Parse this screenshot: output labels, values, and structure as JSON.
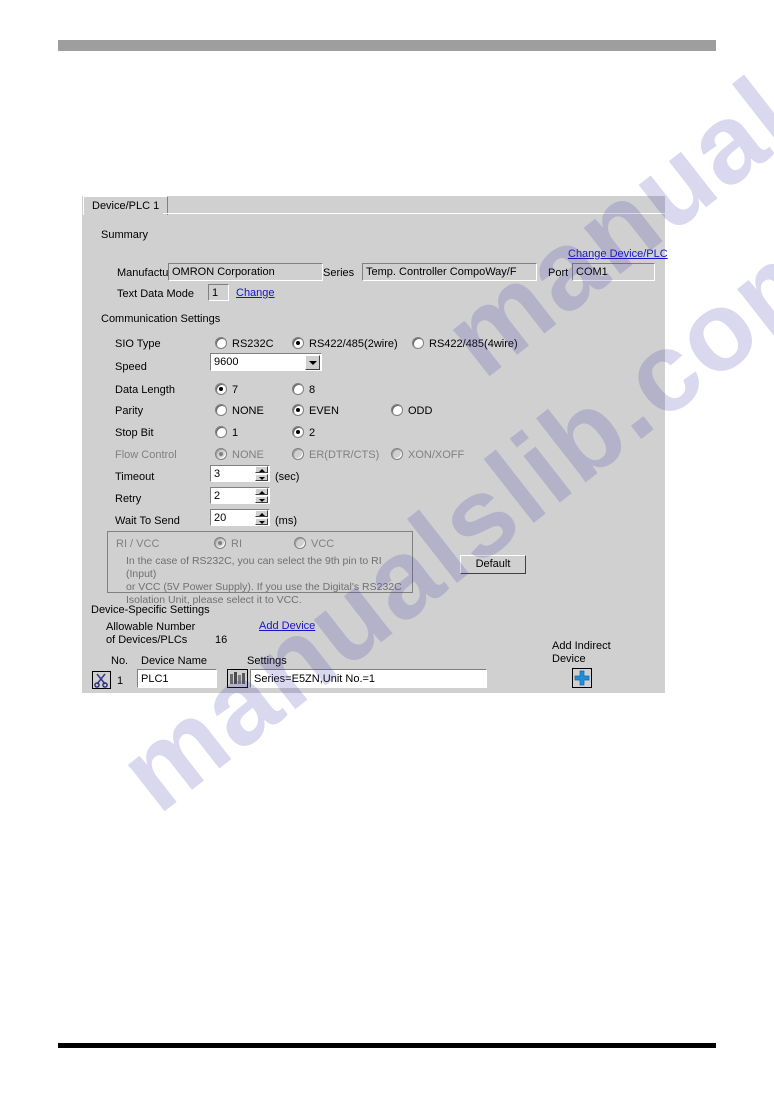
{
  "dialog": {
    "tab_label": "Device/PLC 1",
    "summary": {
      "section_title": "Summary",
      "manufacturer_label": "Manufacturer",
      "manufacturer_value": "OMRON Corporation",
      "series_label": "Series",
      "series_value": "Temp. Controller CompoWay/F",
      "port_label": "Port",
      "port_value": "COM1",
      "text_data_mode_label": "Text Data Mode",
      "text_data_mode_value": "1",
      "change_link": "Change",
      "change_device_link": "Change Device/PLC"
    },
    "communication": {
      "section_title": "Communication Settings",
      "sio_type_label": "SIO Type",
      "sio_options": [
        "RS232C",
        "RS422/485(2wire)",
        "RS422/485(4wire)"
      ],
      "sio_selected": "RS422/485(2wire)",
      "speed_label": "Speed",
      "speed_value": "9600",
      "data_length_label": "Data Length",
      "data_length_options": [
        "7",
        "8"
      ],
      "data_length_selected": "7",
      "parity_label": "Parity",
      "parity_options": [
        "NONE",
        "EVEN",
        "ODD"
      ],
      "parity_selected": "EVEN",
      "stop_bit_label": "Stop Bit",
      "stop_bit_options": [
        "1",
        "2"
      ],
      "stop_bit_selected": "2",
      "flow_control_label": "Flow Control",
      "flow_control_options": [
        "NONE",
        "ER(DTR/CTS)",
        "XON/XOFF"
      ],
      "flow_control_selected": "NONE",
      "timeout_label": "Timeout",
      "timeout_value": "3",
      "timeout_unit": "(sec)",
      "retry_label": "Retry",
      "retry_value": "2",
      "wait_to_send_label": "Wait To Send",
      "wait_to_send_value": "20",
      "wait_to_send_unit": "(ms)"
    },
    "rivcc": {
      "title": "RI / VCC",
      "options": [
        "RI",
        "VCC"
      ],
      "selected": "RI",
      "help_text": "In the case of RS232C, you can select the 9th pin to RI (Input)\nor VCC (5V Power Supply). If you use the Digital's RS232C\nIsolation Unit, please select it to VCC."
    },
    "default_button": "Default",
    "device_specific": {
      "section_title": "Device-Specific Settings",
      "allowable_label_line1": "Allowable Number",
      "allowable_label_line2": "of Devices/PLCs",
      "allowable_count": "16",
      "add_device_link": "Add Device",
      "col_no": "No.",
      "col_device_name": "Device Name",
      "col_settings": "Settings",
      "rows": [
        {
          "no": "1",
          "device_name": "PLC1",
          "settings": "Series=E5ZN,Unit No.=1"
        }
      ],
      "add_indirect_line1": "Add Indirect",
      "add_indirect_line2": "Device"
    }
  },
  "watermark": {
    "text_a": "manualslib.com",
    "text_b": "manualslib.com"
  },
  "colors": {
    "dialog_face": "#d0d0d0",
    "link": "#1414c8",
    "accent_plus": "#1e90d8",
    "top_bar": "#9e9e9e",
    "bottom_bar": "#000000"
  }
}
